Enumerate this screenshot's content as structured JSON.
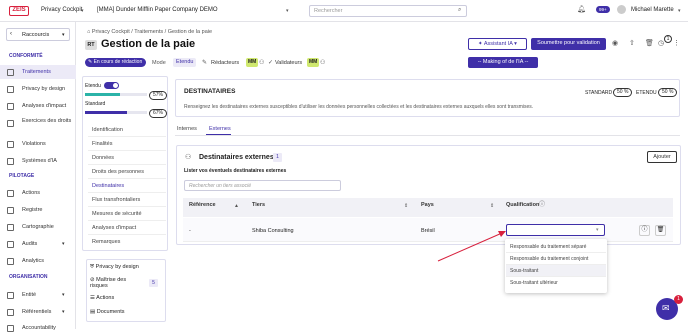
{
  "topbar": {
    "logo": "ZEIS",
    "app": "Privacy Cockpit",
    "company": "[MMA] Dunder Mifflin Paper Company DEMO",
    "search_placeholder": "Rechercher",
    "notif_count": "99+",
    "user": "Michael Marette"
  },
  "sidebar": {
    "shortcuts": "Raccourcis",
    "sections": {
      "conformite": "CONFORMITÉ",
      "pilotage": "PILOTAGE",
      "organisation": "ORGANISATION"
    },
    "items": [
      {
        "label": "Traitements"
      },
      {
        "label": "Privacy by design"
      },
      {
        "label": "Analyses d'impact"
      },
      {
        "label": "Exercices des droits"
      },
      {
        "label": "Violations"
      },
      {
        "label": "Systèmes d'IA"
      },
      {
        "label": "Actions"
      },
      {
        "label": "Registre"
      },
      {
        "label": "Cartographie"
      },
      {
        "label": "Audits"
      },
      {
        "label": "Analytics"
      },
      {
        "label": "Entité"
      },
      {
        "label": "Référentiels"
      },
      {
        "label": "Accountability"
      }
    ]
  },
  "breadcrumb": {
    "b1": "Privacy Cockpit",
    "sep": "/",
    "b2": "Traitements",
    "b3": "Gestion de la paie"
  },
  "header": {
    "badge": "RT",
    "title": "Gestion de la paie",
    "assistant": "Assistant IA",
    "submit": "Soumettre pour validation",
    "making": "-- Making of de l'IA --",
    "status": "En cours de rédaction",
    "mode_label": "Mode",
    "mode_value": "Etendu",
    "redacteurs": "Rédacteurs",
    "validateurs": "Validateurs",
    "avatar": "MM",
    "counter": "1"
  },
  "progress": {
    "etendu_label": "Etendu",
    "standard_label": "Standard",
    "standard_pct": "57%",
    "standard_value": 57,
    "etendu_pct": "67%",
    "etendu_value": 67
  },
  "nav": [
    "Identification",
    "Finalités",
    "Données",
    "Droits des personnes",
    "Destinataires",
    "Flux transfrontaliers",
    "Mesures de sécurité",
    "Analyses d'impact",
    "Remarques"
  ],
  "links": {
    "privacy_by_design": "Privacy by design",
    "maitrise": "Maîtrise des risques",
    "maitrise_count": "5",
    "actions": "Actions",
    "documents": "Documents"
  },
  "dest_header": {
    "title": "DESTINATAIRES",
    "desc": "Renseignez les destinataires externes susceptibles d'utiliser les données personnelles collectées et les destinataires externes auxquels elles sont transmises.",
    "standard": "STANDARD",
    "standard_pct": "50 %",
    "etendu": "ETENDU",
    "etendu_pct": "50 %"
  },
  "tabs": {
    "internes": "Internes",
    "externes": "Externes"
  },
  "externes": {
    "title": "Destinataires externes",
    "count": "1",
    "add": "Ajouter",
    "list_label": "Lister vos éventuels destinataires externes",
    "search_placeholder": "Rechercher un tiers associé"
  },
  "table": {
    "headers": {
      "ref": "Référence",
      "tiers": "Tiers",
      "pays": "Pays",
      "qualif": "Qualification"
    },
    "row": {
      "ref": "-",
      "tiers": "Shiba Consulting",
      "pays": "Brésil"
    }
  },
  "dropdown": [
    "Responsable du traitement séparé",
    "Responsable du traitement conjoint",
    "Sous-traitant",
    "Sous-traitant ultérieur"
  ],
  "chat_badge": "1"
}
